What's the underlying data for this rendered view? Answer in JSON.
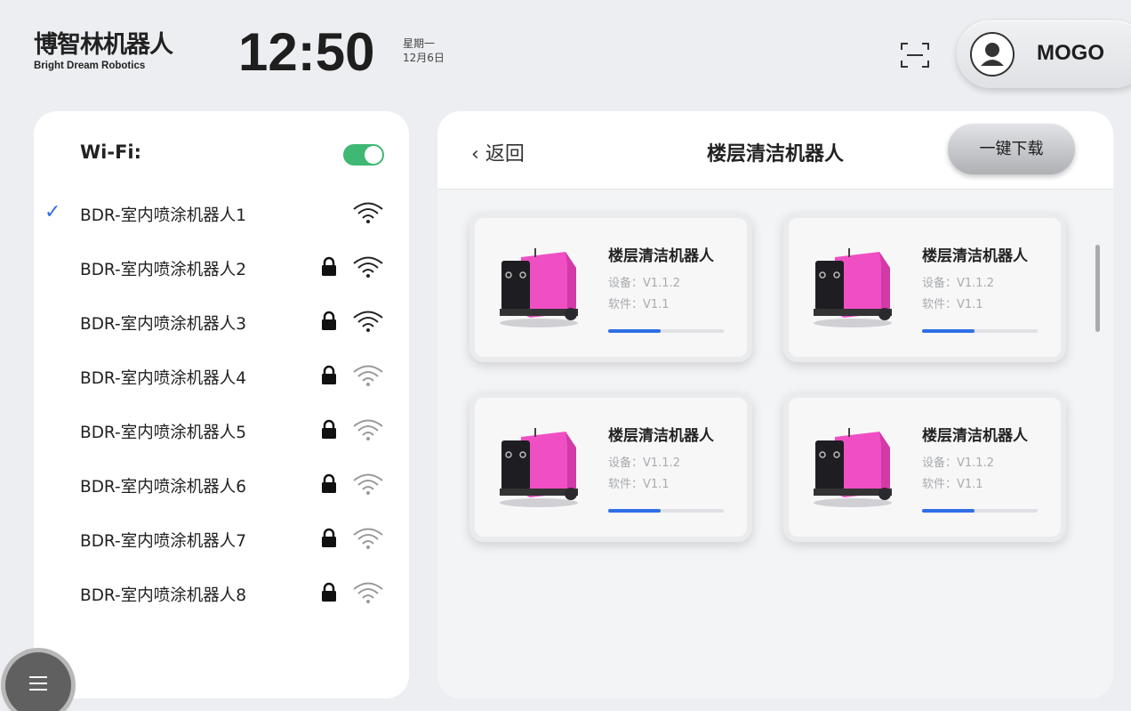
{
  "header": {
    "logo_cn": "博智林机器人",
    "logo_en": "Bright Dream Robotics",
    "time": "12:50",
    "weekday": "星期一",
    "date": "12月6日",
    "username": "MOGO"
  },
  "wifi": {
    "title": "Wi-Fi:",
    "enabled": true,
    "networks": [
      {
        "name": "BDR-室内喷涂机器人1",
        "connected": true,
        "locked": false
      },
      {
        "name": "BDR-室内喷涂机器人2",
        "connected": false,
        "locked": true
      },
      {
        "name": "BDR-室内喷涂机器人3",
        "connected": false,
        "locked": true
      },
      {
        "name": "BDR-室内喷涂机器人4",
        "connected": false,
        "locked": true
      },
      {
        "name": "BDR-室内喷涂机器人5",
        "connected": false,
        "locked": true
      },
      {
        "name": "BDR-室内喷涂机器人6",
        "connected": false,
        "locked": true
      },
      {
        "name": "BDR-室内喷涂机器人7",
        "connected": false,
        "locked": true
      },
      {
        "name": "BDR-室内喷涂机器人8",
        "connected": false,
        "locked": true
      }
    ]
  },
  "main": {
    "back_label": "返回",
    "title": "楼层清洁机器人",
    "download_label": "一键下载",
    "cards": [
      {
        "title": "楼层清洁机器人",
        "device": "设备：V1.1.2",
        "software": "软件：V1.1",
        "progress": 0.45
      },
      {
        "title": "楼层清洁机器人",
        "device": "设备：V1.1.2",
        "software": "软件：V1.1",
        "progress": 0.45
      },
      {
        "title": "楼层清洁机器人",
        "device": "设备：V1.1.2",
        "software": "软件：V1.1",
        "progress": 0.45
      },
      {
        "title": "楼层清洁机器人",
        "device": "设备：V1.1.2",
        "software": "软件：V1.1",
        "progress": 0.45
      }
    ]
  },
  "colors": {
    "accent": "#2f6ee6",
    "toggle_on": "#3eb873",
    "robot_body": "#f04fc4"
  }
}
